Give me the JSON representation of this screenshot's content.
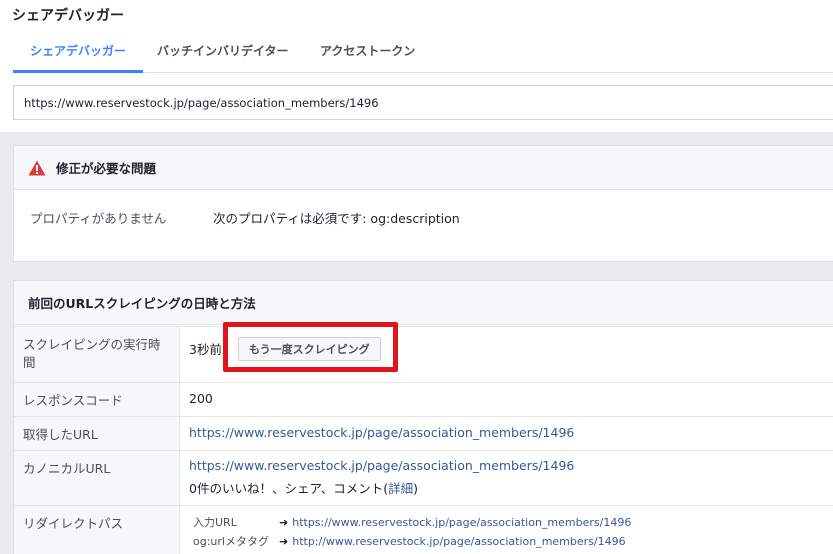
{
  "app": {
    "title": "シェアデバッガー"
  },
  "tabs": [
    {
      "label": "シェアデバッガー",
      "active": true
    },
    {
      "label": "バッチインバリデイター",
      "active": false
    },
    {
      "label": "アクセストークン",
      "active": false
    }
  ],
  "url_input": {
    "value": "https://www.reservestock.jp/page/association_members/1496"
  },
  "problems": {
    "title": "修正が必要な問題",
    "icon": "warning-icon",
    "items": [
      {
        "label": "プロパティがありません",
        "value": "次のプロパティは必須です: og:description"
      }
    ]
  },
  "scrape": {
    "title": "前回のURLスクレイピングの日時と方法",
    "rows": {
      "scrape_time": {
        "label": "スクレイピングの実行時間",
        "value": "3秒前",
        "button": "もう一度スクレイピング"
      },
      "response_code": {
        "label": "レスポンスコード",
        "value": "200"
      },
      "fetched_url": {
        "label": "取得したURL",
        "value": "https://www.reservestock.jp/page/association_members/1496"
      },
      "canonical_url": {
        "label": "カノニカルURL",
        "value": "https://www.reservestock.jp/page/association_members/1496",
        "stats_prefix": "0件のいいね！、シェア、コメント(",
        "stats_link": "詳細",
        "stats_suffix": ")"
      },
      "redirect_path": {
        "label": "リダイレクトパス",
        "lines": [
          {
            "label": "入力URL",
            "arrow": "➜",
            "url": "https://www.reservestock.jp/page/association_members/1496"
          },
          {
            "label": "og:urlメタタグ",
            "arrow": "➜",
            "url": "http://www.reservestock.jp/page/association_members/1496"
          }
        ]
      }
    }
  },
  "colors": {
    "accent": "#4080ff",
    "link": "#365899",
    "warning": "#e0393e",
    "highlight": "#e0151c"
  }
}
